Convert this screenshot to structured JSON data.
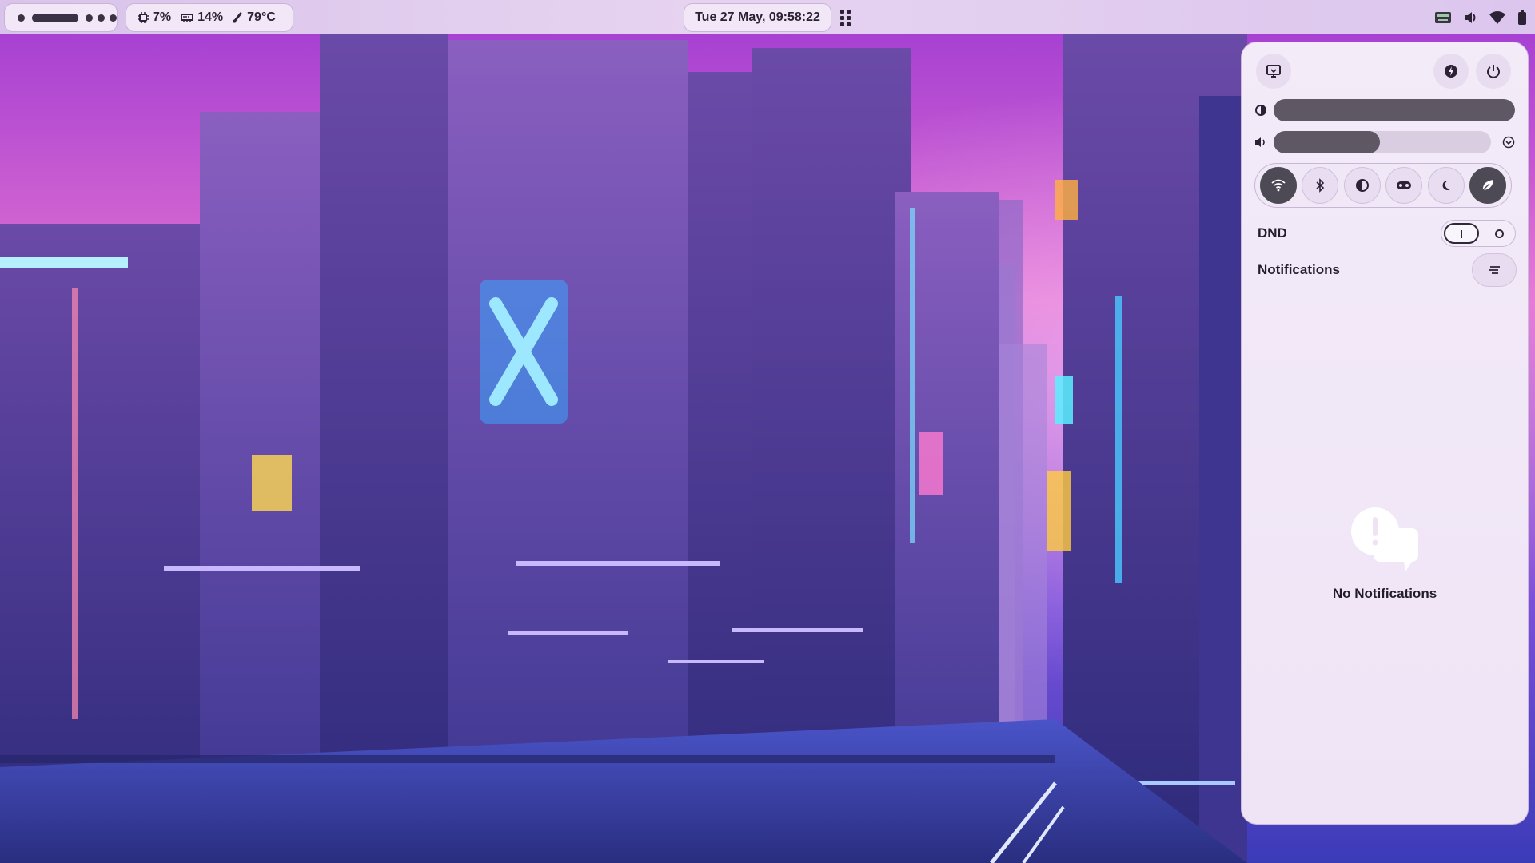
{
  "topbar": {
    "workspaces": {
      "icon": "workspace-dots",
      "active_index": 1,
      "count": 5
    },
    "system": [
      {
        "icon": "cpu-icon",
        "value": "7%"
      },
      {
        "icon": "memory-icon",
        "value": "14%"
      },
      {
        "icon": "thermometer-icon",
        "value": "79°C"
      }
    ],
    "clock": "Tue 27 May, 09:58:22",
    "tray": [
      "keyboard-icon",
      "volume-icon",
      "wifi-icon",
      "battery-icon"
    ]
  },
  "panel": {
    "header_buttons": [
      "screen-icon",
      "bolt-icon",
      "power-icon"
    ],
    "brightness_level": 1.0,
    "volume_level": 0.49,
    "toggles": [
      {
        "icon": "wifi-icon",
        "on": true
      },
      {
        "icon": "bluetooth-icon",
        "on": false
      },
      {
        "icon": "contrast-icon",
        "on": false
      },
      {
        "icon": "gamepad-icon",
        "on": false
      },
      {
        "icon": "moon-icon",
        "on": false
      },
      {
        "icon": "leaf-icon",
        "on": true
      }
    ],
    "dnd_label": "DND",
    "notifications_label": "Notifications",
    "empty_message": "No Notifications"
  },
  "colors": {
    "panel_bg": "#f3ebf8",
    "toggle_on": "#4d4a55",
    "slider_fill": "#5d5864",
    "topbar_bg": "#dcc6ee"
  }
}
